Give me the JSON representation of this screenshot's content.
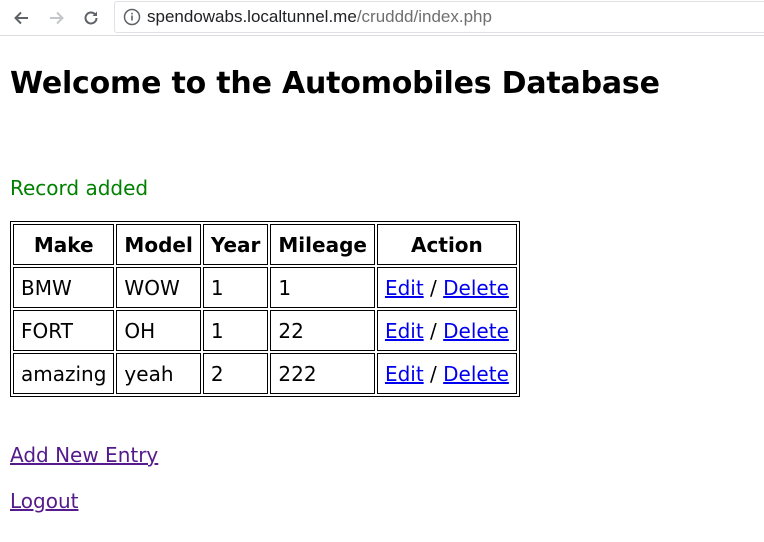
{
  "browser": {
    "url_host": "spendowabs.localtunnel.me",
    "url_path": "/cruddd/index.php"
  },
  "page": {
    "title": "Welcome to the Automobiles Database",
    "status_message": "Record added"
  },
  "table": {
    "headers": {
      "make": "Make",
      "model": "Model",
      "year": "Year",
      "mileage": "Mileage",
      "action": "Action"
    },
    "rows": [
      {
        "make": "BMW",
        "model": "WOW",
        "year": "1",
        "mileage": "1",
        "edit": "Edit",
        "sep": "/",
        "delete": "Delete"
      },
      {
        "make": "FORT",
        "model": "OH",
        "year": "1",
        "mileage": "22",
        "edit": "Edit",
        "sep": "/",
        "delete": "Delete"
      },
      {
        "make": "amazing",
        "model": "yeah",
        "year": "2",
        "mileage": "222",
        "edit": "Edit",
        "sep": "/",
        "delete": "Delete"
      }
    ]
  },
  "links": {
    "add_new": "Add New Entry",
    "logout": "Logout"
  },
  "colors": {
    "status": "#008000",
    "link": "#0000ee",
    "visited_link": "#551a8b"
  }
}
